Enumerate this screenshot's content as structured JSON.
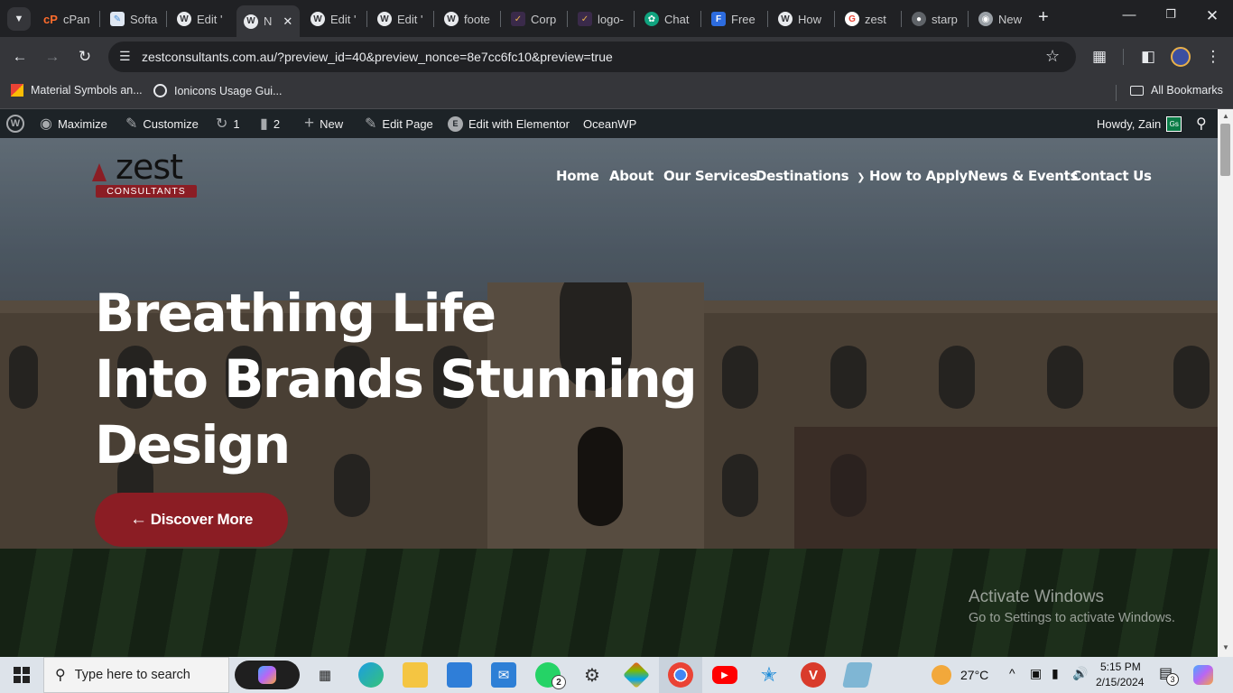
{
  "browser": {
    "tabs": [
      {
        "label": "cPan",
        "icon": "cpanel-icon",
        "color": "#ff6c2c"
      },
      {
        "label": "Softa",
        "icon": "softaculous-icon",
        "color": "#4a90d9"
      },
      {
        "label": "Edit '",
        "icon": "wordpress-icon",
        "color": "#1e8cbe"
      },
      {
        "label": "N",
        "icon": "wordpress-icon",
        "color": "#1e8cbe",
        "active": true
      },
      {
        "label": "Edit '",
        "icon": "wordpress-icon",
        "color": "#1e8cbe"
      },
      {
        "label": "Edit '",
        "icon": "wordpress-icon",
        "color": "#1e8cbe"
      },
      {
        "label": "foote",
        "icon": "wordpress-icon",
        "color": "#1e8cbe"
      },
      {
        "label": "Corp",
        "icon": "brand-icon",
        "color": "#7b4fd6"
      },
      {
        "label": "logo-",
        "icon": "brand-icon",
        "color": "#7b4fd6"
      },
      {
        "label": "Chat",
        "icon": "chatgpt-icon",
        "color": "#10a37f"
      },
      {
        "label": "Free",
        "icon": "free-icon",
        "color": "#2d6cdf"
      },
      {
        "label": "How",
        "icon": "wordpress-icon",
        "color": "#1e8cbe"
      },
      {
        "label": "zest",
        "icon": "google-icon",
        "color": "#ea4335"
      },
      {
        "label": "starp",
        "icon": "globe-icon",
        "color": "#9aa0a6"
      },
      {
        "label": "New",
        "icon": "chrome-icon",
        "color": "#9aa0a6"
      }
    ],
    "url": "zestconsultants.com.au/?preview_id=40&preview_nonce=8e7cc6fc10&preview=true",
    "bookmarks": [
      {
        "label": "Material Symbols an...",
        "icon": "material-symbols-icon"
      },
      {
        "label": "Ionicons Usage Gui...",
        "icon": "ionicons-icon"
      }
    ],
    "all_bookmarks": "All Bookmarks"
  },
  "wp_admin_bar": {
    "site": "Maximize",
    "customize": "Customize",
    "updates": "1",
    "comments": "2",
    "new": "New",
    "edit_page": "Edit Page",
    "edit_elementor": "Edit with Elementor",
    "theme": "OceanWP",
    "howdy": "Howdy, Zain",
    "avatar_initials": "Gs"
  },
  "site": {
    "logo": {
      "word": "zest",
      "sub": "CONSULTANTS"
    },
    "nav": [
      "Home",
      "About",
      "Our Services",
      "Destinations",
      "How to Apply",
      "News & Events",
      "Contact Us"
    ],
    "headline": [
      "Breathing Life",
      "Into Brands Stunning",
      "Design"
    ],
    "cta": "Discover More",
    "colors": {
      "accent": "#8b1d24"
    }
  },
  "watermark": {
    "title": "Activate Windows",
    "subtitle": "Go to Settings to activate Windows."
  },
  "taskbar": {
    "search_placeholder": "Type here to search",
    "whatsapp_badge": "2",
    "weather": "27°C",
    "time": "5:15 PM",
    "date": "2/15/2024",
    "notification_count": "3"
  }
}
